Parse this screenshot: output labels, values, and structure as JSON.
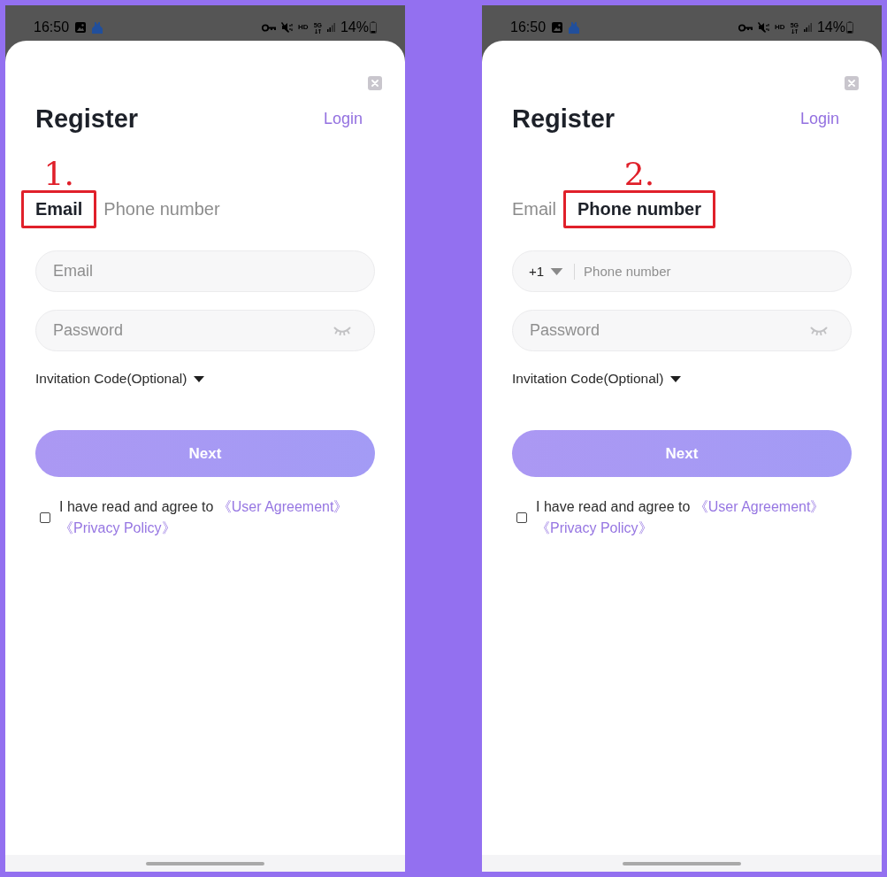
{
  "phones": [
    {
      "status_bar": {
        "time": "16:50",
        "quality": "HD",
        "network": "5G",
        "battery": "14%"
      },
      "dialog": {
        "title": "Register",
        "login_link": "Login",
        "tabs": [
          {
            "label": "Email",
            "selected": true,
            "highlighted": true,
            "step": "1."
          },
          {
            "label": "Phone number",
            "selected": false,
            "highlighted": false
          }
        ],
        "fields": [
          {
            "kind": "email",
            "placeholder": "Email"
          },
          {
            "kind": "password",
            "placeholder": "Password"
          }
        ],
        "invitation_code": {
          "label": "Invitation Code(Optional)",
          "expanded": false
        },
        "next_button": {
          "label": "Next",
          "disabled": true
        },
        "agreement": {
          "checked": false,
          "text": "I have read and agree to",
          "links": [
            "《User Agreement》",
            "《Privacy Policy》"
          ]
        }
      }
    },
    {
      "status_bar": {
        "time": "16:50",
        "quality": "HD",
        "network": "5G",
        "battery": "14%"
      },
      "dialog": {
        "title": "Register",
        "login_link": "Login",
        "tabs": [
          {
            "label": "Email",
            "selected": false,
            "highlighted": false
          },
          {
            "label": "Phone number",
            "selected": true,
            "highlighted": true,
            "step": "2."
          }
        ],
        "fields": [
          {
            "kind": "phone",
            "country_code": "+1",
            "placeholder": "Phone number"
          },
          {
            "kind": "password",
            "placeholder": "Password"
          }
        ],
        "invitation_code": {
          "label": "Invitation Code(Optional)",
          "expanded": false
        },
        "next_button": {
          "label": "Next",
          "disabled": true
        },
        "agreement": {
          "checked": false,
          "text": "I have read and agree to",
          "links": [
            "《User Agreement》",
            "《Privacy Policy》"
          ]
        }
      }
    }
  ]
}
